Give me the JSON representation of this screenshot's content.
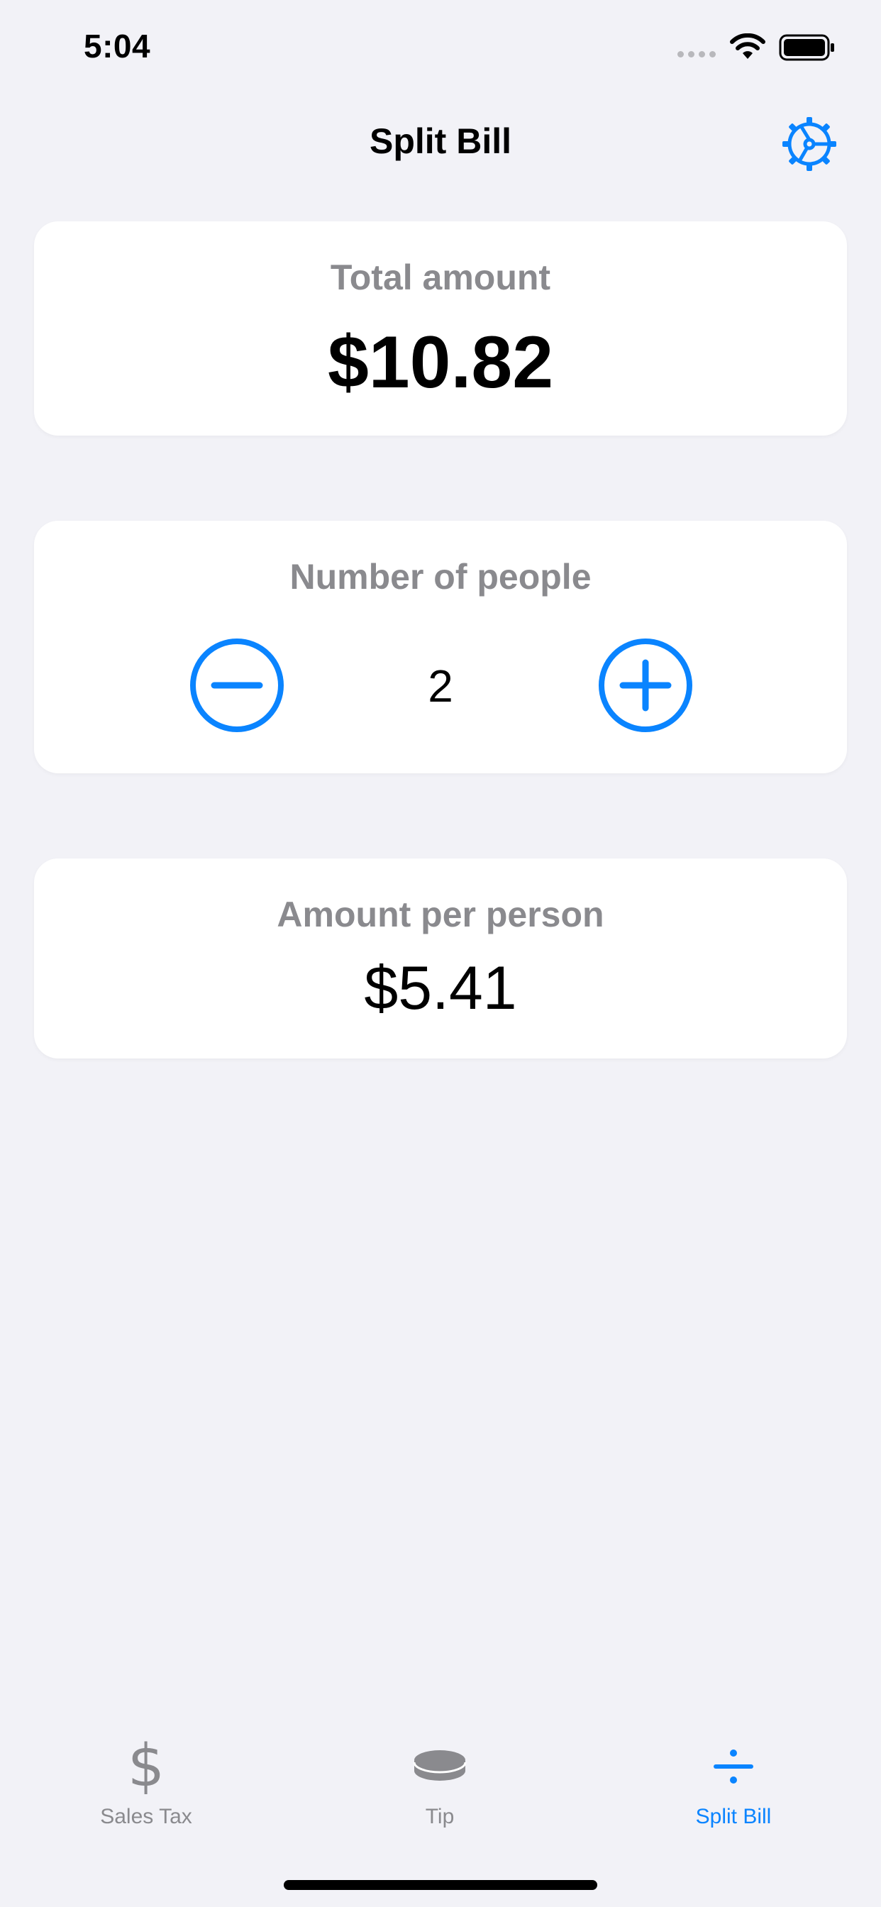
{
  "status_bar": {
    "time": "5:04"
  },
  "nav": {
    "title": "Split Bill",
    "settings_icon": "gear-icon"
  },
  "total_card": {
    "label": "Total amount",
    "value": "$10.82"
  },
  "people_card": {
    "label": "Number of people",
    "count": "2",
    "decrement_icon": "minus-circle-icon",
    "increment_icon": "plus-circle-icon"
  },
  "per_person_card": {
    "label": "Amount per person",
    "value": "$5.41"
  },
  "tab_bar": {
    "tabs": [
      {
        "label": "Sales Tax",
        "icon": "dollar-icon",
        "selected": false
      },
      {
        "label": "Tip",
        "icon": "coin-stack-icon",
        "selected": false
      },
      {
        "label": "Split Bill",
        "icon": "divide-icon",
        "selected": true
      }
    ]
  },
  "colors": {
    "accent": "#0A84FF",
    "background": "#F2F2F7",
    "card": "#FFFFFF",
    "secondary_text": "#8A8A8E",
    "primary_text": "#000000"
  }
}
